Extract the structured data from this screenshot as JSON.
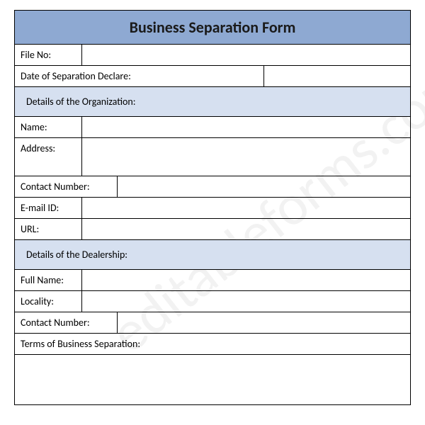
{
  "watermark": "editableforms.com",
  "title": "Business Separation Form",
  "rows": {
    "file_no": "File No:",
    "date_sep": "Date of Separation Declare:",
    "org_header": "Details of the Organization:",
    "name": "Name:",
    "address": "Address:",
    "contact": "Contact Number:",
    "email": "E-mail ID:",
    "url": "URL:",
    "dealer_header": "Details of the Dealership:",
    "full_name": "Full Name:",
    "locality": "Locality:",
    "contact2": "Contact Number:",
    "terms": "Terms of Business Separation:"
  }
}
